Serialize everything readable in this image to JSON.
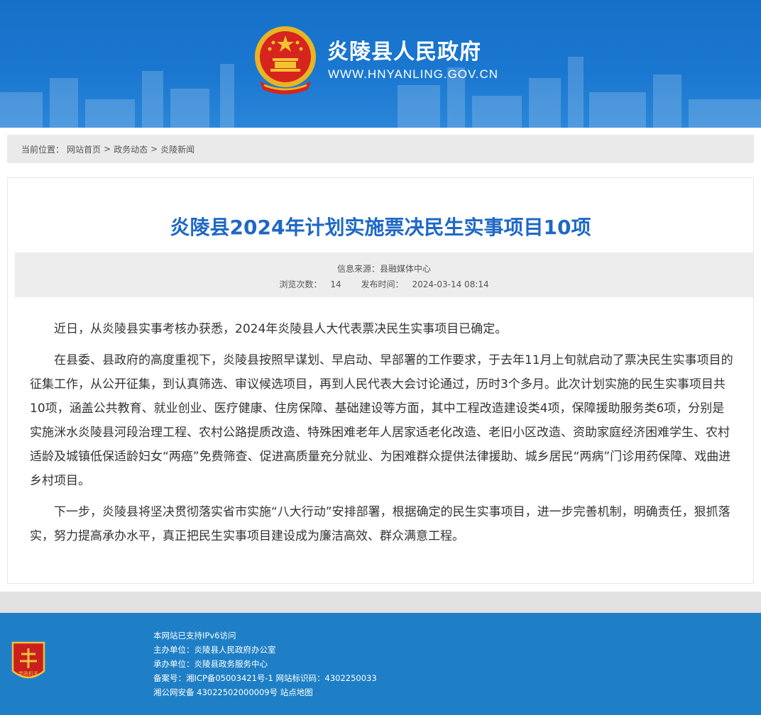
{
  "header": {
    "site_title": "炎陵县人民政府",
    "site_url": "WWW.HNYANLING.GOV.CN",
    "bg_color": "#1a77d0"
  },
  "breadcrumb": {
    "prefix": "当前位置：",
    "items": [
      "网站首页",
      "政务动态",
      "炎陵新闻"
    ],
    "separator": ">"
  },
  "article": {
    "title": "炎陵县2024年计划实施票决民生实事项目10项",
    "title_color": "#1e68c6",
    "source_label": "信息来源：",
    "source_value": "县融媒体中心",
    "views_label": "浏览次数：",
    "views_value": "14",
    "published_label": "发布时间：",
    "published_value": "2024-03-14 08:14",
    "paragraphs": [
      "近日，从炎陵县实事考核办获悉，2024年炎陵县人大代表票决民生实事项目已确定。",
      "在县委、县政府的高度重视下，炎陵县按照早谋划、早启动、早部署的工作要求，于去年11月上旬就启动了票决民生实事项目的征集工作，从公开征集，到认真筛选、审议候选项目，再到人民代表大会讨论通过，历时3个多月。此次计划实施的民生实事项目共10项，涵盖公共教育、就业创业、医疗健康、住房保障、基础建设等方面，其中工程改造建设类4项，保障援助服务类6项，分别是实施洣水炎陵县河段治理工程、农村公路提质改造、特殊困难老年人居家适老化改造、老旧小区改造、资助家庭经济困难学生、农村适龄及城镇低保适龄妇女“两癌”免费筛查、促进高质量充分就业、为困难群众提供法律援助、城乡居民“两病”门诊用药保障、戏曲进乡村项目。",
      "下一步，炎陵县将坚决贯彻落实省市实施“八大行动”安排部署，根据确定的民生实事项目，进一步完善机制，明确责任，狠抓落实，努力提高承办水平，真正把民生实事项目建设成为廉洁高效、群众满意工程。"
    ]
  },
  "footer": {
    "badge_text": "党政机关",
    "lines": [
      "本网站已支持IPv6访问",
      "主办单位：炎陵县人民政府办公室",
      "承办单位：炎陵县政务服务中心",
      "备案号：湘ICP备05003421号-1 网站标识码：4302250033",
      "湘公网安备 43022502000009号 站点地图"
    ],
    "bg_color": "#1e7fc6"
  }
}
